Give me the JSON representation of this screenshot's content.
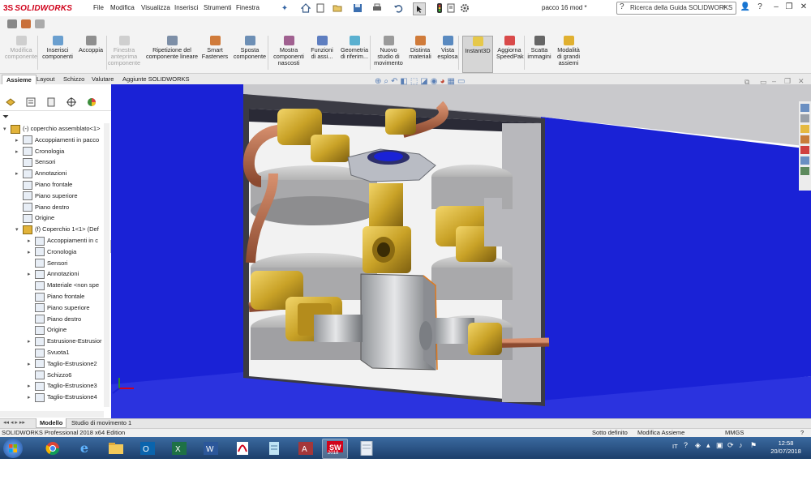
{
  "app": {
    "brand": "SOLIDWORKS",
    "document_title": "pacco 16 mod *",
    "search_placeholder": "Ricerca della Guida SOLIDWORKS"
  },
  "menu": [
    "File",
    "Modifica",
    "Visualizza",
    "Inserisci",
    "Strumenti",
    "Finestra"
  ],
  "ribbon": [
    {
      "label": "Modifica\ncomponente",
      "enabled": false
    },
    {
      "label": "Inserisci\ncomponenti",
      "enabled": true
    },
    {
      "label": "Accoppia",
      "enabled": true
    },
    {
      "label": "Finestra\nanteprima\ncomponente",
      "enabled": false
    },
    {
      "label": "Ripetizione del\ncomponente lineare",
      "enabled": true
    },
    {
      "label": "Smart\nFasteners",
      "enabled": true
    },
    {
      "label": "Sposta\ncomponente",
      "enabled": true
    },
    {
      "label": "Mostra\ncomponenti\nnascosti",
      "enabled": true
    },
    {
      "label": "Funzioni\ndi assi...",
      "enabled": true
    },
    {
      "label": "Geometria\ndi riferim...",
      "enabled": true
    },
    {
      "label": "Nuovo\nstudio di\nmovimento",
      "enabled": true
    },
    {
      "label": "Distinta\nmateriali",
      "enabled": true
    },
    {
      "label": "Vista\nesplosa",
      "enabled": true
    },
    {
      "label": "Instant3D",
      "enabled": true,
      "active": true
    },
    {
      "label": "Aggiorna\nSpeedPak",
      "enabled": true
    },
    {
      "label": "Scatta\nimmagini",
      "enabled": true
    },
    {
      "label": "Modalità\ndi grandi\nassiemi",
      "enabled": true
    }
  ],
  "tabs": [
    "Assieme",
    "Layout",
    "Schizzo",
    "Valutare",
    "Aggiunte SOLIDWORKS"
  ],
  "active_tab": "Assieme",
  "tree": [
    {
      "label": "(-) coperchio assemblato<1>",
      "level": 0,
      "expander": "▾"
    },
    {
      "label": "Accoppiamenti in pacco",
      "level": 1,
      "expander": "▸"
    },
    {
      "label": "Cronologia",
      "level": 1,
      "expander": "▸"
    },
    {
      "label": "Sensori",
      "level": 1,
      "expander": ""
    },
    {
      "label": "Annotazioni",
      "level": 1,
      "expander": "▸"
    },
    {
      "label": "Piano frontale",
      "level": 1,
      "expander": ""
    },
    {
      "label": "Piano superiore",
      "level": 1,
      "expander": ""
    },
    {
      "label": "Piano destro",
      "level": 1,
      "expander": ""
    },
    {
      "label": "Origine",
      "level": 1,
      "expander": ""
    },
    {
      "label": "(f) Coperchio 1<1> (Def",
      "level": 1,
      "expander": "▾"
    },
    {
      "label": "Accoppiamenti in c",
      "level": 2,
      "expander": "▸"
    },
    {
      "label": "Cronologia",
      "level": 2,
      "expander": "▸"
    },
    {
      "label": "Sensori",
      "level": 2,
      "expander": ""
    },
    {
      "label": "Annotazioni",
      "level": 2,
      "expander": "▸"
    },
    {
      "label": "Materiale <non spe",
      "level": 2,
      "expander": ""
    },
    {
      "label": "Piano frontale",
      "level": 2,
      "expander": ""
    },
    {
      "label": "Piano superiore",
      "level": 2,
      "expander": ""
    },
    {
      "label": "Piano destro",
      "level": 2,
      "expander": ""
    },
    {
      "label": "Origine",
      "level": 2,
      "expander": ""
    },
    {
      "label": "Estrusione-Estrusior",
      "level": 2,
      "expander": "▸"
    },
    {
      "label": "Svuota1",
      "level": 2,
      "expander": ""
    },
    {
      "label": "Taglio-Estrusione2",
      "level": 2,
      "expander": "▸"
    },
    {
      "label": "Schizzo6",
      "level": 2,
      "expander": ""
    },
    {
      "label": "Taglio-Estrusione3",
      "level": 2,
      "expander": "▸"
    },
    {
      "label": "Taglio-Estrusione4",
      "level": 2,
      "expander": "▸"
    }
  ],
  "model_tabs": [
    "Modello",
    "Studio di movimento 1"
  ],
  "status": {
    "left": "SOLIDWORKS Professional 2018 x64 Edition",
    "state": "Sotto definito",
    "mode": "Modifica Assieme",
    "units": "MMGS"
  },
  "taskbar": {
    "language": "IT",
    "time": "12:58",
    "date": "20/07/2018",
    "sw_badge": "2018"
  },
  "colors": {
    "viewport_blue": "#1a22d6",
    "brass": "#c9a227",
    "copper": "#b46a4a",
    "accent_red": "#d0021b"
  }
}
